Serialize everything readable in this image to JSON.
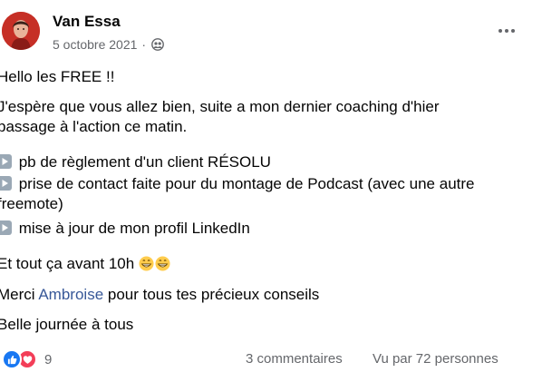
{
  "post": {
    "author": {
      "name": "Van Essa"
    },
    "date": "5 octobre 2021",
    "separator": "·",
    "audience_icon": "friends-audience-icon",
    "body": {
      "greeting": "Hello les FREE !!",
      "intro": "J'espère que vous allez bien, suite a mon dernier coaching d'hier passage à l'action ce matin.",
      "items": [
        " pb de règlement d'un client RÉSOLU",
        " prise de contact faite pour du montage de Podcast (avec une autre freemote)",
        " mise à jour de mon profil LinkedIn"
      ],
      "before_10h": "Et tout ça avant 10h ",
      "thanks_prefix": "Merci ",
      "thanks_mention": "Ambroise",
      "thanks_suffix": " pour tous tes précieux conseils",
      "closing": "Belle journée à tous"
    },
    "footer": {
      "reactions_count": "9",
      "comments": "3 commentaires",
      "views": "Vu par 72 personnes"
    }
  },
  "colors": {
    "text": "#050505",
    "secondary": "#65676b",
    "mention": "#385898",
    "like": "#1877f2",
    "love": "#f33e58"
  }
}
